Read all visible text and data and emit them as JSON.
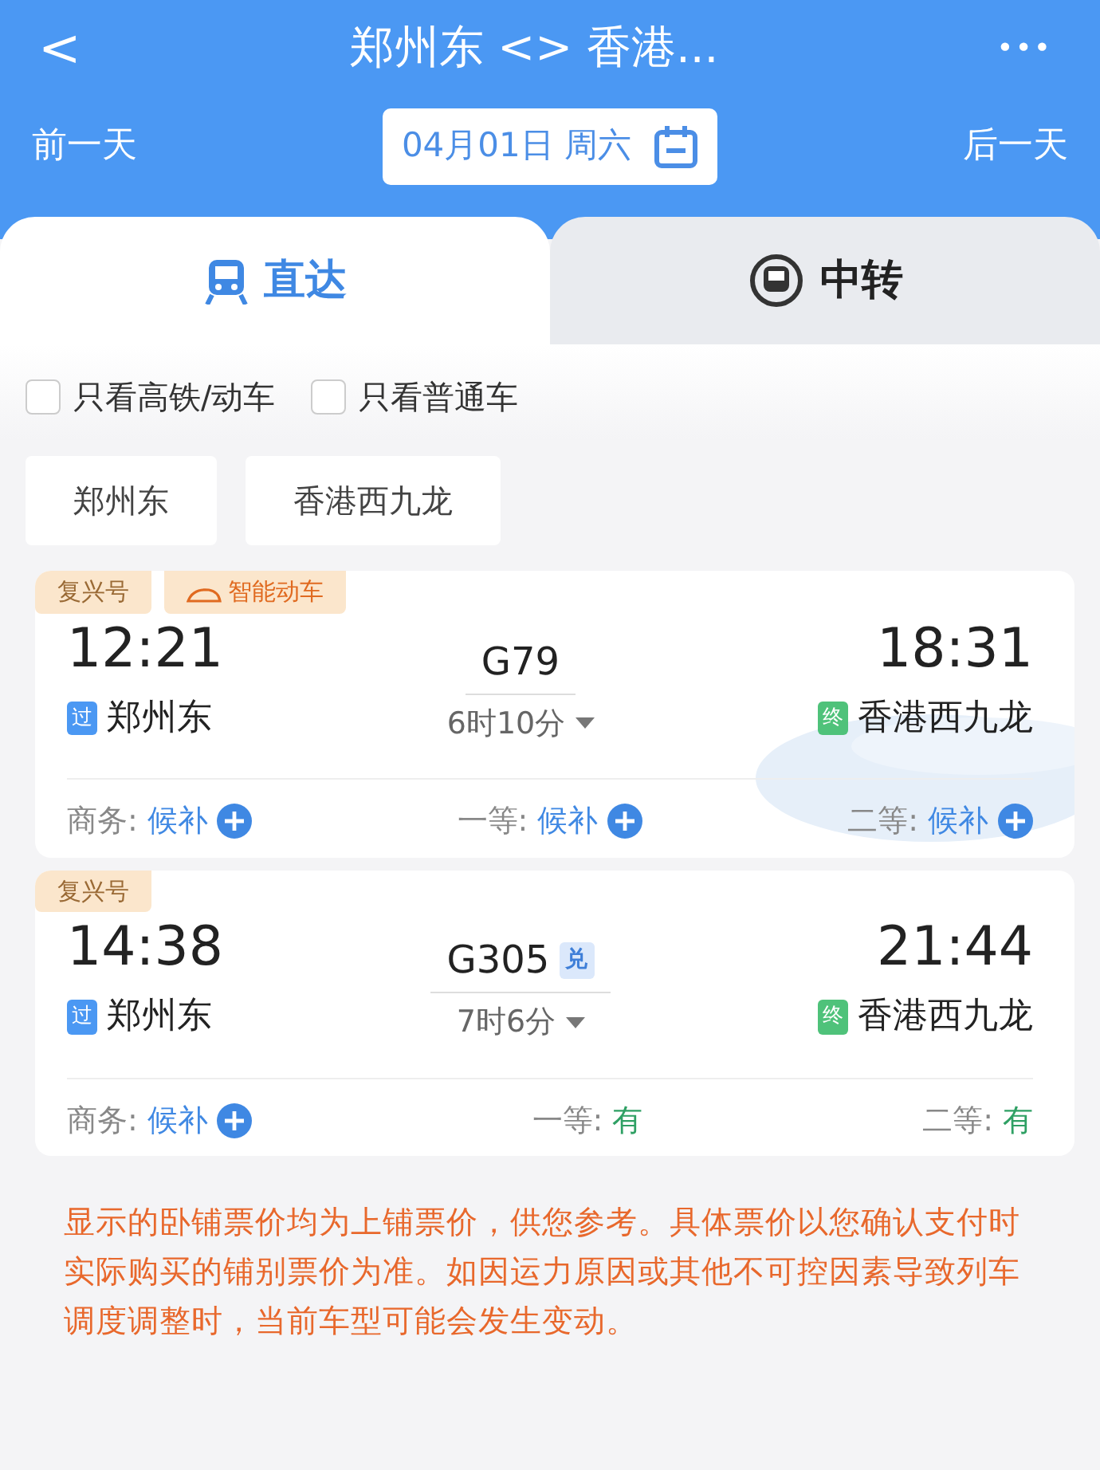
{
  "header": {
    "back": "<",
    "title": "郑州东 <> 香港...",
    "more": "•••",
    "prev_day": "前一天",
    "date": "04月01日 周六",
    "next_day": "后一天"
  },
  "tabs": [
    {
      "label": "直达",
      "selected": true
    },
    {
      "label": "中转",
      "selected": false
    }
  ],
  "filters": [
    {
      "label": "只看高铁/动车",
      "checked": false
    },
    {
      "label": "只看普通车",
      "checked": false
    }
  ],
  "stations": [
    "郑州东",
    "香港西九龙"
  ],
  "trains": [
    {
      "tags": [
        {
          "label": "复兴号",
          "kind": "plain"
        },
        {
          "label": "智能动车",
          "kind": "smart"
        }
      ],
      "depart": "12:21",
      "train_no": "G79",
      "arrive": "18:31",
      "from_mark": "过",
      "from": "郑州东",
      "duration": "6时10分",
      "to_mark": "终",
      "to": "香港西九龙",
      "seats": [
        {
          "label": "商务:",
          "status": "候补",
          "kind": "waitlist"
        },
        {
          "label": "一等:",
          "status": "候补",
          "kind": "waitlist"
        },
        {
          "label": "二等:",
          "status": "候补",
          "kind": "waitlist"
        }
      ]
    },
    {
      "tags": [
        {
          "label": "复兴号",
          "kind": "plain"
        }
      ],
      "depart": "14:38",
      "train_no": "G305",
      "exchange": "兑",
      "arrive": "21:44",
      "from_mark": "过",
      "from": "郑州东",
      "duration": "7时6分",
      "to_mark": "终",
      "to": "香港西九龙",
      "seats": [
        {
          "label": "商务:",
          "status": "候补",
          "kind": "waitlist"
        },
        {
          "label": "一等:",
          "status": "有",
          "kind": "available"
        },
        {
          "label": "二等:",
          "status": "有",
          "kind": "available"
        }
      ]
    }
  ],
  "notice": "显示的卧铺票价均为上铺票价，供您参考。具体票价以您确认支付时实际购买的铺别票价为准。如因运力原因或其他不可控因素导致列车调度调整时，当前车型可能会发生变动。"
}
